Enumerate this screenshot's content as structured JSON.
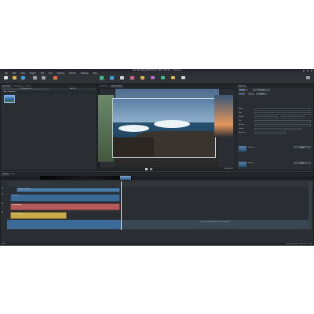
{
  "window": {
    "title": "Nou Montage [WCP-03] (1,180 x 580 P) — Kdenlive"
  },
  "menu": [
    "File",
    "Edit",
    "View",
    "Project",
    "Tool",
    "Clip",
    "Timeline",
    "Monitor",
    "Settings",
    "Help"
  ],
  "toolbar": {
    "left": [
      {
        "icon": "new-document-icon",
        "label": "New"
      },
      {
        "icon": "open-folder-icon",
        "label": "Open"
      },
      {
        "icon": "save-icon",
        "label": "Save"
      },
      {
        "icon": "undo-icon",
        "label": "Undo"
      },
      {
        "icon": "redo-icon",
        "label": "Redo"
      },
      {
        "icon": "render-icon",
        "label": "Render"
      }
    ],
    "right": [
      {
        "icon": "logging-icon",
        "label": "Logging"
      },
      {
        "icon": "editing-icon",
        "label": "Editing"
      },
      {
        "icon": "audio-icon",
        "label": "Audio"
      },
      {
        "icon": "effects-icon",
        "label": "Effects"
      },
      {
        "icon": "color-icon",
        "label": "Color"
      }
    ]
  },
  "bin": {
    "tabs": [
      "Project Bin",
      "Compositions",
      "Effects"
    ],
    "row2": [
      "Clip Properties",
      "Add Clip"
    ],
    "breadcrumb": "Clips  ›  Seascape",
    "clip_name": "Sea.jpg"
  },
  "monitor": {
    "tabs": [
      "Clip Monitor",
      "Project Monitor"
    ],
    "timecode": "00:00:07:21"
  },
  "properties": {
    "title": "Properties",
    "tabs": [
      "Compositing",
      "Transform"
    ],
    "fields": [
      "Name",
      "Type",
      "Position",
      "Size",
      "Rotation",
      "Opacity",
      "Alignment"
    ],
    "apply_label": "Apply",
    "preset_label": "Default",
    "list": [
      "Transition",
      "Dissolve"
    ]
  },
  "timeline": {
    "tabs": [
      "Timeline",
      "Mixer"
    ],
    "tracks": [
      {
        "name": "V2",
        "clip": "Sea.jpg  |  Seascape",
        "color": "#4a7ca8"
      },
      {
        "name": "V1",
        "clip": "Color Clip",
        "color": "#3b6a96"
      },
      {
        "name": "A1",
        "clip": "Sea Audio.mp3",
        "color": "#b45a5a"
      },
      {
        "name": "A2",
        "clip": "Music Track.ogg",
        "color": "#c9a94a"
      }
    ],
    "hint": "Select a clip in the timeline to edit its properties"
  },
  "status": {
    "left": "Ready",
    "right": "Display: 1280x720 · 00:00:07:21 · 25fps"
  }
}
